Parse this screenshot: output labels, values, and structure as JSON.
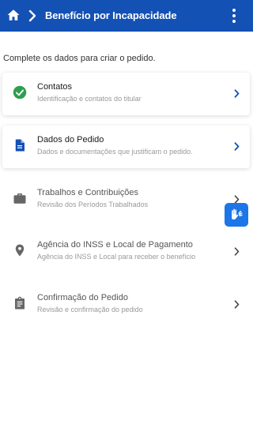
{
  "header": {
    "title": "Benefício por Incapacidade",
    "home_icon": "home-icon",
    "menu_icon": "more-vert-icon",
    "background": "#1351b4"
  },
  "intro_text": "Complete os dados para criar o pedido.",
  "steps": [
    {
      "title": "Contatos",
      "subtitle": "Identificação e contatos do titular",
      "icon": "check-circle-icon",
      "state": "completed"
    },
    {
      "title": "Dados do Pedido",
      "subtitle": "Dados e documentações que justificam o pedido.",
      "icon": "document-icon",
      "state": "current"
    },
    {
      "title": "Trabalhos e Contribuições",
      "subtitle": "Revisão dos Períodos Trabalhados",
      "icon": "briefcase-icon",
      "state": "pending"
    },
    {
      "title": "Agência do INSS e Local de Pagamento",
      "subtitle": "Agência do INSS e Local para receber o benefício",
      "icon": "location-pin-icon",
      "state": "pending"
    },
    {
      "title": "Confirmação do Pedido",
      "subtitle": "Revisão e confirmação do pedido",
      "icon": "clipboard-icon",
      "state": "pending"
    }
  ],
  "accessibility_widget": {
    "icon": "sign-language-hands-icon",
    "color": "#1c76e8"
  },
  "colors": {
    "success": "#2e9e4f",
    "primary": "#1351b4",
    "muted_icon": "#666666"
  }
}
